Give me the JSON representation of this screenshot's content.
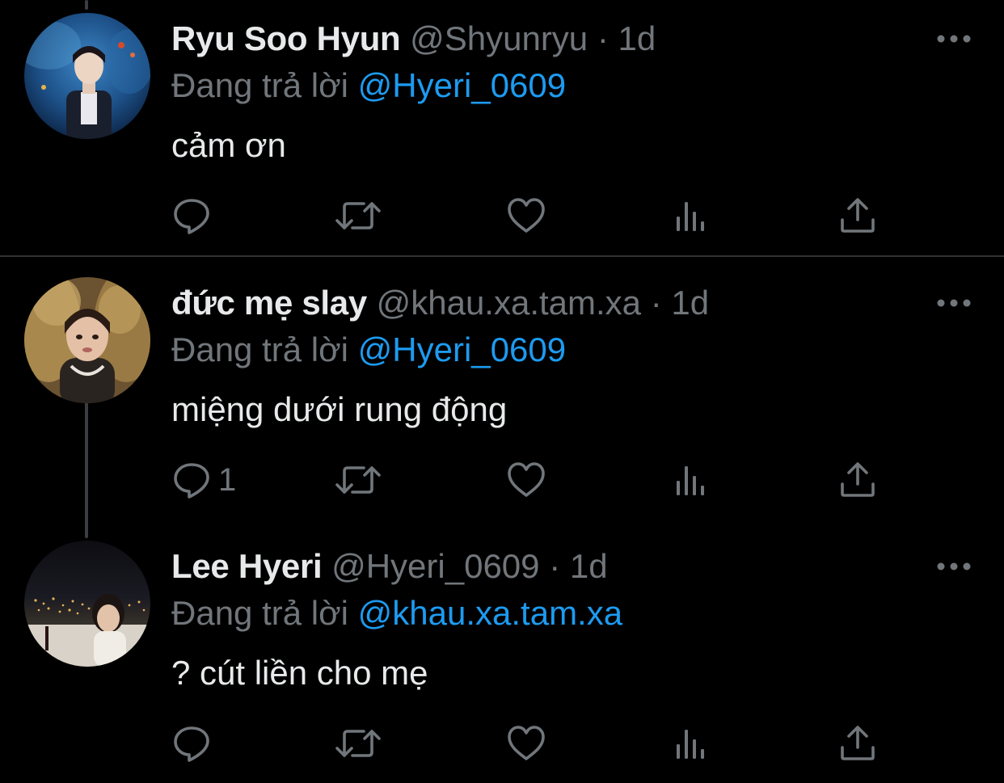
{
  "colors": {
    "background": "#000000",
    "primary_text": "#e7e9ea",
    "secondary_text": "#71767b",
    "accent": "#1d9bf0",
    "divider": "#2f3336"
  },
  "tweets": [
    {
      "display_name": "Ryu Soo Hyun",
      "handle": "@Shyunryu",
      "separator": "·",
      "time": "1d",
      "reply_prefix": "Đang trả lời",
      "reply_to": "@Hyeri_0609",
      "text": "cảm ơn",
      "reply_count": "",
      "avatar_icon": "avatar-aquarium"
    },
    {
      "display_name": "đức mẹ slay",
      "handle": "@khau.xa.tam.xa",
      "separator": "·",
      "time": "1d",
      "reply_prefix": "Đang trả lời",
      "reply_to": "@Hyeri_0609",
      "text": "miệng dưới rung động",
      "reply_count": "1",
      "avatar_icon": "avatar-doll-fur"
    },
    {
      "display_name": "Lee Hyeri",
      "handle": "@Hyeri_0609",
      "separator": "·",
      "time": "1d",
      "reply_prefix": "Đang trả lời",
      "reply_to": "@khau.xa.tam.xa",
      "text": "? cút liền cho mẹ",
      "reply_count": "",
      "avatar_icon": "avatar-night-city"
    }
  ],
  "action_icons": [
    "reply-icon",
    "retweet-icon",
    "like-icon",
    "views-icon",
    "share-icon"
  ],
  "more_icon": "more-options-icon"
}
